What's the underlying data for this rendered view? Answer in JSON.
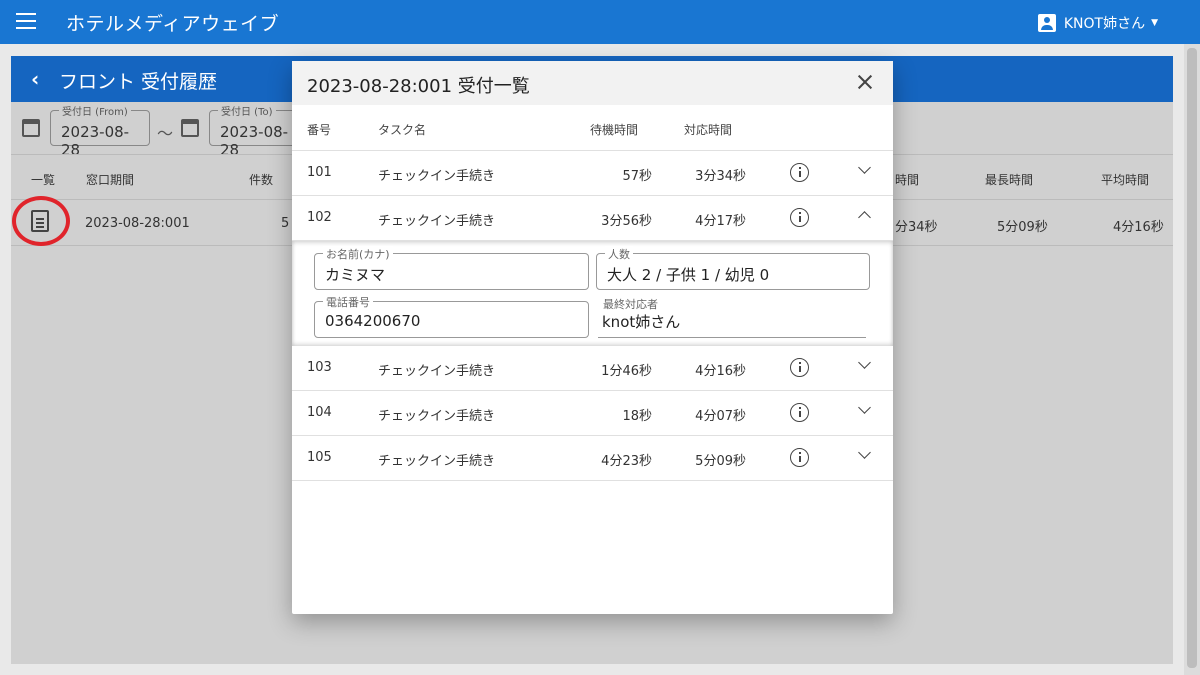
{
  "app": {
    "title": "ホテルメディアウェイブ",
    "user": "KNOT姉さん"
  },
  "page": {
    "title": "フロント 受付履歴",
    "from_label": "受付日 (From)",
    "from_value": "2023-08-28",
    "to_label": "受付日 (To)",
    "to_value": "2023-08-28",
    "tilde": "〜",
    "columns": [
      "一覧",
      "窓口期間",
      "件数",
      "時間",
      "最長時間",
      "平均時間"
    ],
    "row": {
      "period": "2023-08-28:001",
      "count": "5",
      "time": "分34秒",
      "max": "5分09秒",
      "avg": "4分16秒"
    }
  },
  "modal": {
    "title": "2023-08-28:001  受付一覧",
    "columns": {
      "num": "番号",
      "task": "タスク名",
      "wait": "待機時間",
      "resp": "対応時間"
    },
    "rows": [
      {
        "num": "101",
        "task": "チェックイン手続き",
        "wait": "57秒",
        "resp": "3分34秒"
      },
      {
        "num": "102",
        "task": "チェックイン手続き",
        "wait": "3分56秒",
        "resp": "4分17秒"
      },
      {
        "num": "103",
        "task": "チェックイン手続き",
        "wait": "1分46秒",
        "resp": "4分16秒"
      },
      {
        "num": "104",
        "task": "チェックイン手続き",
        "wait": "18秒",
        "resp": "4分07秒"
      },
      {
        "num": "105",
        "task": "チェックイン手続き",
        "wait": "4分23秒",
        "resp": "5分09秒"
      }
    ],
    "detail": {
      "name_label": "お名前(カナ)",
      "name_value": "カミヌマ",
      "people_label": "人数",
      "people_value": "大人 2 / 子供 1 / 幼児 0",
      "phone_label": "電話番号",
      "phone_value": "0364200670",
      "last_label": "最終対応者",
      "last_value": "knot姉さん"
    }
  }
}
